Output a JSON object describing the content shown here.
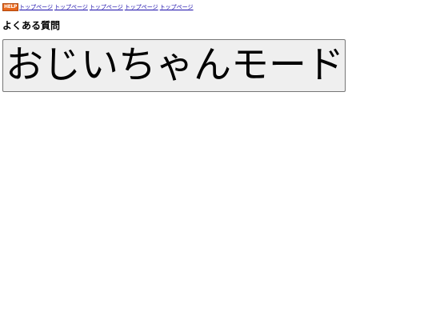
{
  "header": {
    "logo_text": "HELP",
    "nav_links": [
      "トップページ",
      "トップページ",
      "トップページ",
      "トップページ",
      "トップページ"
    ]
  },
  "main": {
    "title": "よくある質問",
    "mode_button_label": "おじいちゃんモード"
  },
  "colors": {
    "link": "#1a0dab",
    "logo_background": "#e8671b",
    "button_background": "#efefef"
  }
}
